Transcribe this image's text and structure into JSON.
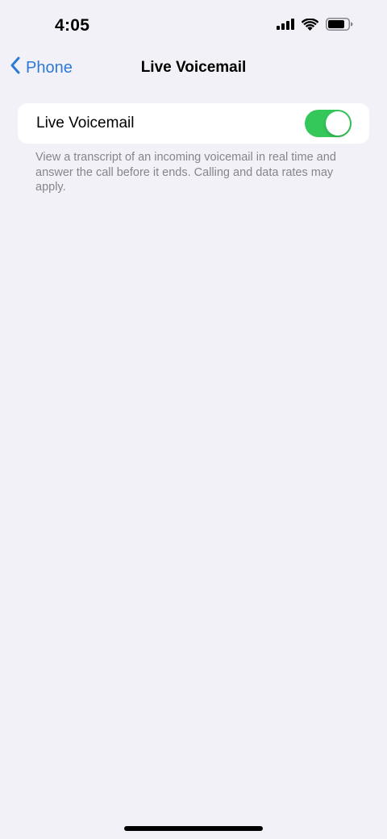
{
  "status_bar": {
    "time": "4:05",
    "icons": [
      "cellular-signal-icon",
      "wifi-icon",
      "battery-icon"
    ]
  },
  "nav": {
    "back_label": "Phone",
    "title": "Live Voicemail"
  },
  "settings": {
    "live_voicemail": {
      "label": "Live Voicemail",
      "enabled": true,
      "on_color": "#34c759"
    },
    "footer": "View a transcript of an incoming voicemail in real time and answer the call before it ends. Calling and data rates may apply."
  },
  "colors": {
    "background": "#f2f1f7",
    "accent": "#2c7ad6",
    "footer_text": "#86858b"
  }
}
